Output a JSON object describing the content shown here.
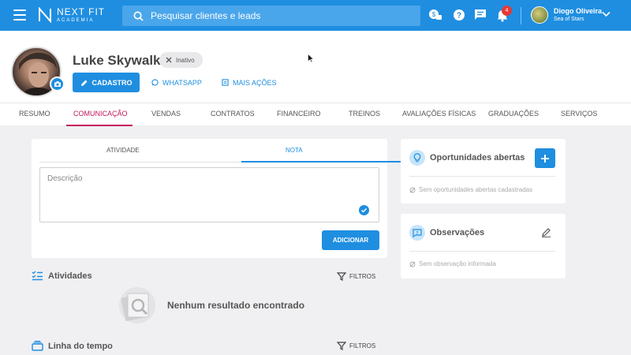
{
  "app": {
    "logo_title": "NEXT FIT",
    "logo_subtitle": "ACADEMIA",
    "search_placeholder": "Pesquisar clientes e leads",
    "notification_count": "4",
    "user_name": "Diogo Oliveira",
    "user_subtitle": "Sea of Stars",
    "accent_color": "#1f8ee0"
  },
  "profile": {
    "name": "Luke Skywalker",
    "status": "Inativo",
    "actions": {
      "cadastro": "CADASTRO",
      "whatsapp": "WHATSAPP",
      "mais_acoes": "MAIS AÇÕES"
    }
  },
  "tabs": [
    "RESUMO",
    "COMUNICAÇÃO",
    "VENDAS",
    "CONTRATOS",
    "FINANCEIRO",
    "TREINOS",
    "AVALIAÇÕES FÍSICAS",
    "GRADUAÇÕES",
    "SERVIÇOS"
  ],
  "note_panel": {
    "tab_activity": "ATIVIDADE",
    "tab_note": "NOTA",
    "description_placeholder": "Descrição",
    "add_button": "ADICIONAR"
  },
  "activities": {
    "title": "Atividades",
    "filter_label": "FILTROS",
    "empty_text": "Nenhum resultado encontrado"
  },
  "timeline": {
    "title": "Linha do tempo",
    "filter_label": "FILTROS"
  },
  "opportunities": {
    "title": "Oportunidades abertas",
    "empty_text": "Sem oportunidades abertas cadastradas"
  },
  "observations": {
    "title": "Observações",
    "empty_text": "Sem observação informada"
  }
}
